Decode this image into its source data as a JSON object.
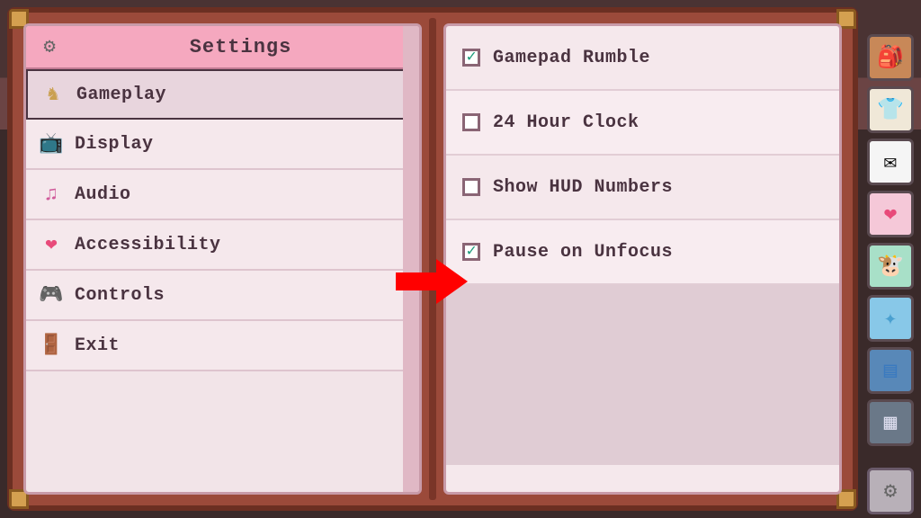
{
  "header": {
    "title": "Settings"
  },
  "nav": {
    "items": [
      {
        "label": "Gameplay",
        "icon": "knight",
        "selected": true
      },
      {
        "label": "Display",
        "icon": "tv",
        "selected": false
      },
      {
        "label": "Audio",
        "icon": "audio",
        "selected": false
      },
      {
        "label": "Accessibility",
        "icon": "heart",
        "selected": false
      },
      {
        "label": "Controls",
        "icon": "pad",
        "selected": false
      },
      {
        "label": "Exit",
        "icon": "door",
        "selected": false
      }
    ]
  },
  "options": [
    {
      "label": "Gamepad Rumble",
      "checked": true
    },
    {
      "label": "24 Hour Clock",
      "checked": false
    },
    {
      "label": "Show HUD Numbers",
      "checked": false
    },
    {
      "label": "Pause on Unfocus",
      "checked": true
    }
  ],
  "side_tabs": [
    {
      "name": "inventory",
      "icon": "bag",
      "color": "brown"
    },
    {
      "name": "outfit",
      "icon": "shirt",
      "color": "cream"
    },
    {
      "name": "mail",
      "icon": "mail",
      "color": "white"
    },
    {
      "name": "relations",
      "icon": "heart",
      "color": "pink"
    },
    {
      "name": "animals",
      "icon": "cow",
      "color": "green"
    },
    {
      "name": "skills",
      "icon": "sparkle",
      "color": "blue"
    },
    {
      "name": "quests",
      "icon": "quest",
      "color": "dblue"
    },
    {
      "name": "collections",
      "icon": "book",
      "color": "gray"
    },
    {
      "name": "settings",
      "icon": "gear",
      "color": "gear"
    }
  ],
  "annotation": {
    "arrow_target": "Pause on Unfocus"
  }
}
